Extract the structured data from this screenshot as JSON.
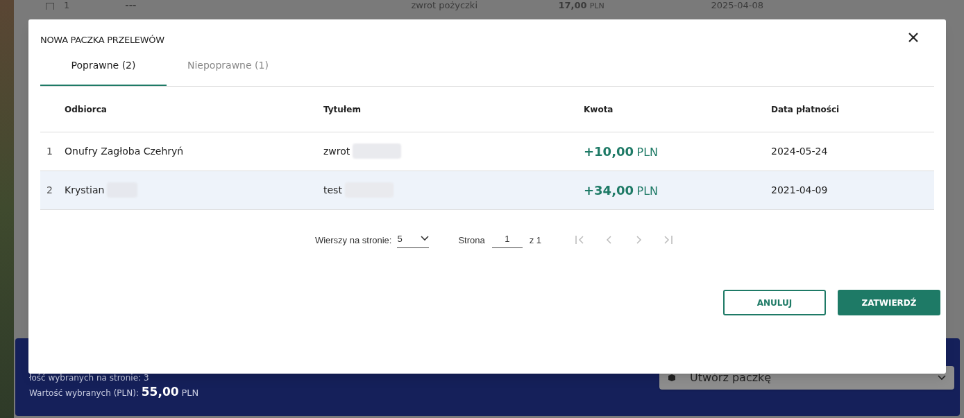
{
  "background_row": {
    "number": "1",
    "dash": "---",
    "title": "zwrot pożyczki",
    "amount": "17,00",
    "currency": "PLN",
    "date": "2025-04-08"
  },
  "summary_bar": {
    "count_label": "łość wybranych na stronie: 3",
    "value_label": "Wartość wybranych (PLN):",
    "value": "55,00",
    "currency": "PLN",
    "action_dropdown": "Utwórz paczkę"
  },
  "dialog": {
    "title": "NOWA PACZKA PRZELEWÓW",
    "tabs": [
      {
        "label": "Poprawne (2)",
        "selected": true
      },
      {
        "label": "Niepoprawne (1)",
        "selected": false
      }
    ],
    "table": {
      "columns": [
        "Odbiorca",
        "Tytułem",
        "Kwota",
        "Data płatności"
      ],
      "rows": [
        {
          "number": "1",
          "recipient": "Onufry Zagłoba Czehryń",
          "recipient_redacted": false,
          "title": "zwrot",
          "amount": "+10,00",
          "currency": "PLN",
          "date": "2024-05-24",
          "selected": false
        },
        {
          "number": "2",
          "recipient": "Krystian",
          "recipient_redacted": true,
          "title": "test",
          "amount": "+34,00",
          "currency": "PLN",
          "date": "2021-04-09",
          "selected": true
        }
      ]
    },
    "pagination": {
      "rows_label": "Wierszy na stronie:",
      "rows_value": "5",
      "page_label": "Strona",
      "page_value": "1",
      "of_label": "z 1"
    },
    "buttons": [
      {
        "label": "ANULUJ",
        "kind": "secondary"
      },
      {
        "label": "ZATWIERDŹ",
        "kind": "primary"
      }
    ]
  }
}
